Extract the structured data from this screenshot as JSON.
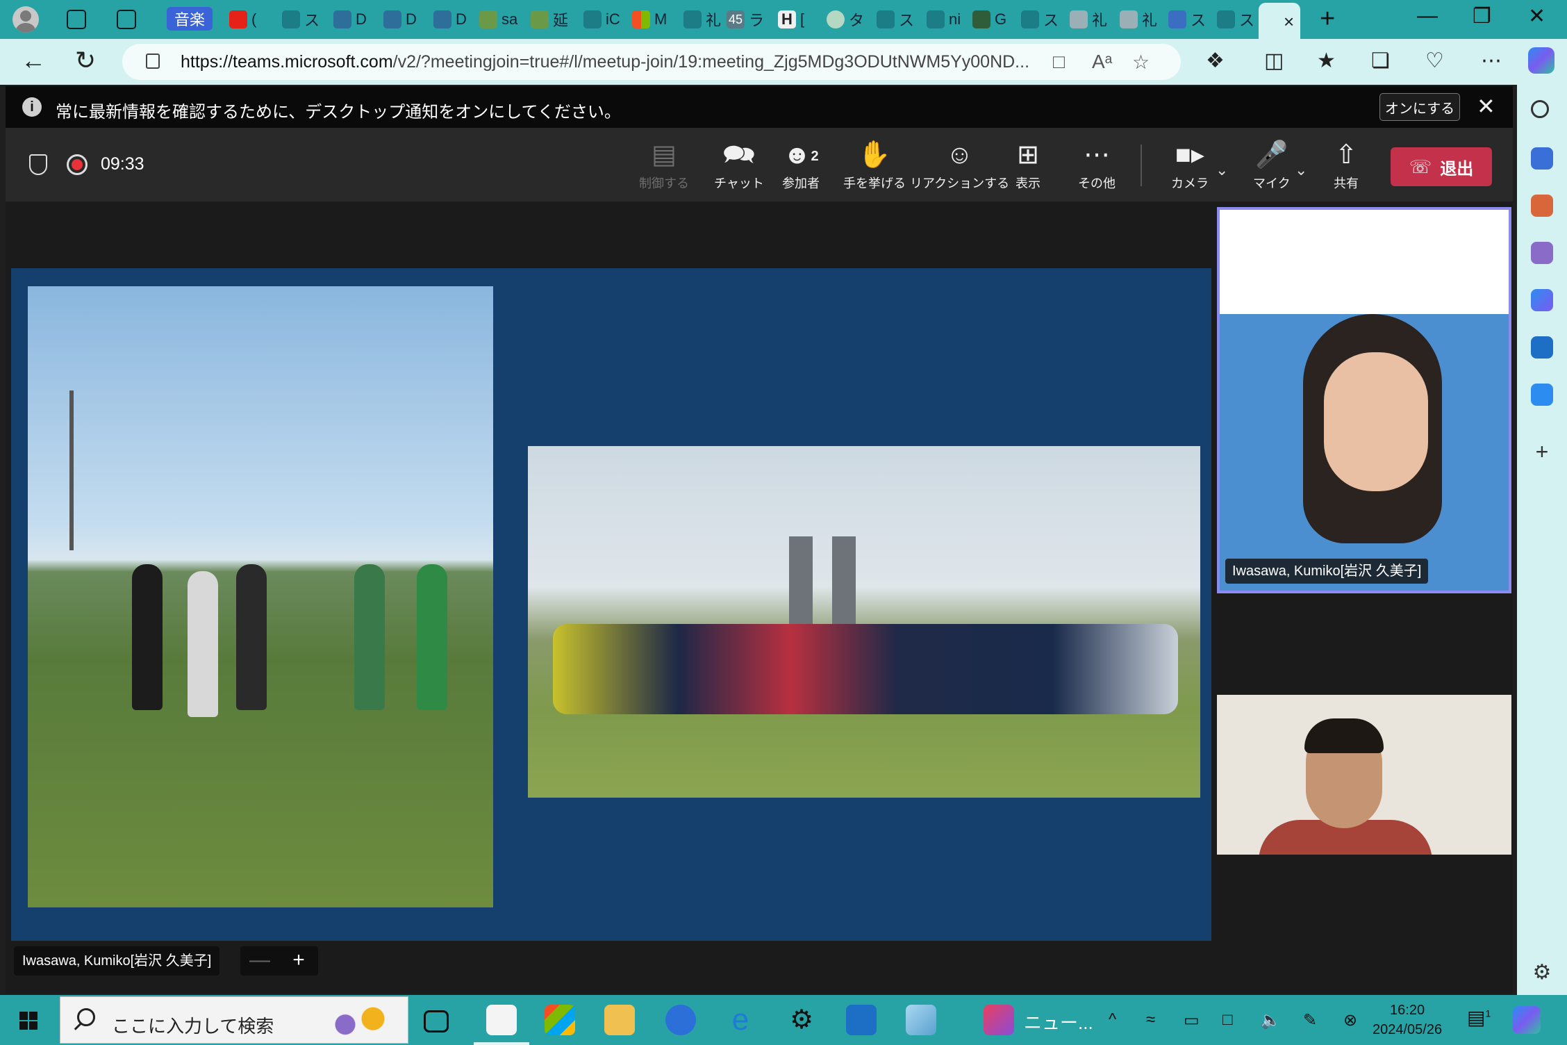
{
  "browser": {
    "tab_badge": "音楽",
    "active_tab_close": "×",
    "new_tab": "+",
    "tab_minis": [
      "(",
      "ス",
      "D",
      "D",
      "D",
      "sa",
      "延",
      "iC",
      "M",
      "礼",
      "45",
      "ラ",
      "H",
      "[",
      "タ",
      "ス",
      "ni",
      "G",
      "ス",
      "礼",
      "礼",
      "ス",
      "ス"
    ],
    "window_controls": {
      "minimize": "—",
      "restore": "❐",
      "close": "✕"
    },
    "address": {
      "domain": "https://teams.microsoft.com",
      "path": "/v2/?meetingjoin=true#/l/meetup-join/19:meeting_Zjg5MDg3ODUtNWM5Yy00ND..."
    }
  },
  "notification": {
    "message": "常に最新情報を確認するために、デスクトップ通知をオンにしてください。",
    "turn_on_button": "オンにする"
  },
  "meeting_toolbar": {
    "timer": "09:33",
    "buttons": [
      {
        "id": "control",
        "label": "制御する",
        "disabled": true
      },
      {
        "id": "chat",
        "label": "チャット"
      },
      {
        "id": "people",
        "label": "参加者",
        "count": "2"
      },
      {
        "id": "raise",
        "label": "手を挙げる"
      },
      {
        "id": "react",
        "label": "リアクションする"
      },
      {
        "id": "view",
        "label": "表示"
      },
      {
        "id": "more",
        "label": "その他"
      },
      {
        "id": "camera",
        "label": "カメラ"
      },
      {
        "id": "mic",
        "label": "マイク"
      },
      {
        "id": "share",
        "label": "共有"
      }
    ],
    "leave_label": "退出"
  },
  "participants": {
    "presenter_tile_name": "Iwasawa, Kumiko[岩沢 久美子]",
    "share_owner_chip": "Iwasawa, Kumiko[岩沢 久美子]",
    "zoom_minus": "—",
    "zoom_plus": "+"
  },
  "taskbar": {
    "search_placeholder": "ここに入力して検索",
    "app_label": "ニュー...",
    "time": "16:20",
    "date": "2024/05/26",
    "notifications_count": "1"
  },
  "colors": {
    "browser_accent": "#27a3a6",
    "browser_light": "#d4f2f1",
    "share_background": "#15406e",
    "leave_button": "#c4314b",
    "active_speaker_border": "#8c8cf0"
  }
}
